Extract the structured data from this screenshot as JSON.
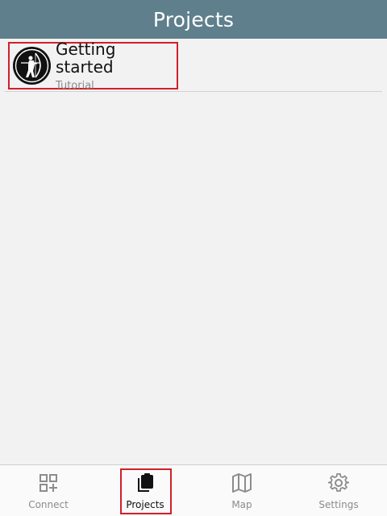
{
  "header": {
    "title": "Projects"
  },
  "projects": [
    {
      "title": "Getting started",
      "subtitle": "Tutorial",
      "icon": "archer-icon"
    }
  ],
  "nav": {
    "items": [
      {
        "label": "Connect",
        "icon": "qr-connect-icon"
      },
      {
        "label": "Projects",
        "icon": "clipboard-icon",
        "active": true
      },
      {
        "label": "Map",
        "icon": "map-icon"
      },
      {
        "label": "Settings",
        "icon": "gear-icon"
      }
    ]
  },
  "colors": {
    "header_bg": "#5f7f8d",
    "highlight": "#d0202a",
    "inactive": "#8c8c8c"
  }
}
